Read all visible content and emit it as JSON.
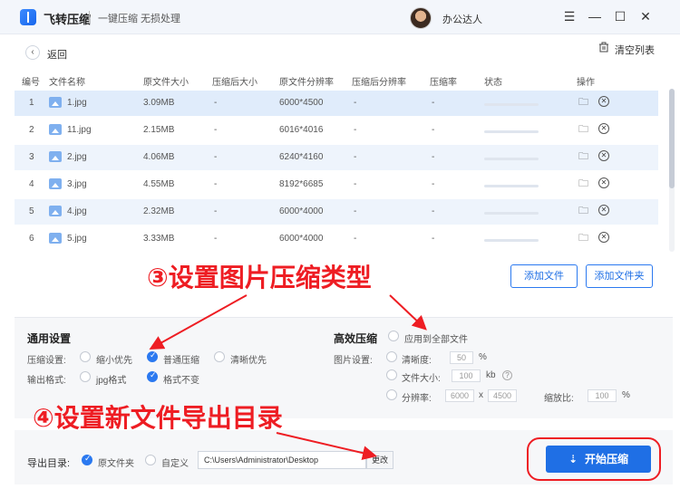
{
  "titlebar": {
    "app_name": "飞转压缩",
    "subtitle": "一键压缩 无损处理",
    "username": "办公达人"
  },
  "toolbar": {
    "back_label": "返回",
    "clear_label": "清空列表"
  },
  "table": {
    "headers": [
      "编号",
      "文件名称",
      "原文件大小",
      "压缩后大小",
      "原文件分辨率",
      "压缩后分辨率",
      "压缩率",
      "状态",
      "操作"
    ],
    "rows": [
      {
        "no": "1",
        "name": "1.jpg",
        "size": "3.09MB",
        "csize": "-",
        "res": "6000*4500",
        "cres": "-",
        "rate": "-"
      },
      {
        "no": "2",
        "name": "11.jpg",
        "size": "2.15MB",
        "csize": "-",
        "res": "6016*4016",
        "cres": "-",
        "rate": "-"
      },
      {
        "no": "3",
        "name": "2.jpg",
        "size": "4.06MB",
        "csize": "-",
        "res": "6240*4160",
        "cres": "-",
        "rate": "-"
      },
      {
        "no": "4",
        "name": "3.jpg",
        "size": "4.55MB",
        "csize": "-",
        "res": "8192*6685",
        "cres": "-",
        "rate": "-"
      },
      {
        "no": "5",
        "name": "4.jpg",
        "size": "2.32MB",
        "csize": "-",
        "res": "6000*4000",
        "cres": "-",
        "rate": "-"
      },
      {
        "no": "6",
        "name": "5.jpg",
        "size": "3.33MB",
        "csize": "-",
        "res": "6000*4000",
        "cres": "-",
        "rate": "-"
      }
    ]
  },
  "buttons": {
    "add_file": "添加文件",
    "add_folder": "添加文件夹",
    "start": "开始压缩",
    "change": "更改"
  },
  "general": {
    "title": "通用设置",
    "compress_label": "压缩设置:",
    "opt_small": "缩小优先",
    "opt_normal": "普通压缩",
    "opt_clear": "清晰优先",
    "format_label": "输出格式:",
    "opt_jpg": "jpg格式",
    "opt_keep": "格式不变"
  },
  "efficient": {
    "title": "高效压缩",
    "apply_all": "应用到全部文件",
    "img_label": "图片设置:",
    "clarity": "清晰度:",
    "clarity_val": "50",
    "pct": "%",
    "filesize": "文件大小:",
    "filesize_val": "100",
    "kb": "kb",
    "help": "?",
    "resolution": "分辨率:",
    "res_w": "6000",
    "x": "x",
    "res_h": "4500",
    "scale": "缩放比:",
    "scale_val": "100",
    "pct2": "%"
  },
  "export": {
    "label": "导出目录:",
    "opt_source": "原文件夹",
    "opt_custom": "自定义",
    "path": "C:\\Users\\Administrator\\Desktop"
  },
  "annotations": {
    "step3": "③设置图片压缩类型",
    "step4": "④设置新文件导出目录"
  },
  "colors": {
    "accent": "#1f6fe5",
    "annotation": "#ee1d23",
    "row_highlight": "#eef4fc"
  }
}
